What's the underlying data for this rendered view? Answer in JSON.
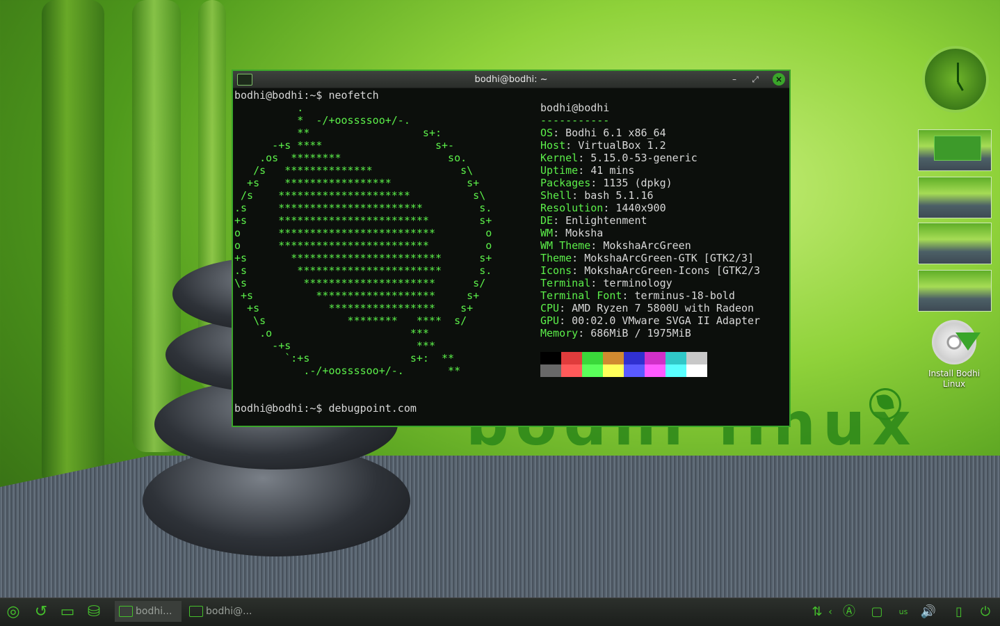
{
  "window": {
    "title": "bodhi@bodhi: ~"
  },
  "terminal": {
    "prompt_1": "bodhi@bodhi:~$ neofetch",
    "prompt_2": "bodhi@bodhi:~$ debugpoint.com",
    "ascii_art": [
      "          .",
      "          *  -/+oossssoo+/-.",
      "          **                  s+:",
      "      -+s ****                  s+-",
      "    .os  ********                 so.",
      "   /s   **************              s\\",
      "  +s    *****************            s+",
      " /s    *********************          s\\",
      ".s     ***********************         s.",
      "+s     ************************        s+",
      "o      *************************        o",
      "o      ************************         o",
      "+s       ************************      s+",
      ".s        ***********************      s.",
      "\\s         *********************      s/",
      " +s          *******************     s+",
      "  +s           *****************    s+",
      "   \\s             ********   ****  s/",
      "    .o                      ***",
      "      -+s                    ***",
      "        `:+s                s+:  **",
      "           .-/+oossssoo+/-.       **"
    ],
    "user_host": "bodhi@bodhi",
    "separator": "-----------",
    "info": [
      {
        "label": "OS",
        "value": "Bodhi 6.1 x86_64"
      },
      {
        "label": "Host",
        "value": "VirtualBox 1.2"
      },
      {
        "label": "Kernel",
        "value": "5.15.0-53-generic"
      },
      {
        "label": "Uptime",
        "value": "41 mins"
      },
      {
        "label": "Packages",
        "value": "1135 (dpkg)"
      },
      {
        "label": "Shell",
        "value": "bash 5.1.16"
      },
      {
        "label": "Resolution",
        "value": "1440x900"
      },
      {
        "label": "DE",
        "value": "Enlightenment"
      },
      {
        "label": "WM",
        "value": "Moksha"
      },
      {
        "label": "WM Theme",
        "value": "MokshaArcGreen"
      },
      {
        "label": "Theme",
        "value": "MokshaArcGreen-GTK [GTK2/3]"
      },
      {
        "label": "Icons",
        "value": "MokshaArcGreen-Icons [GTK2/3"
      },
      {
        "label": "Terminal",
        "value": "terminology"
      },
      {
        "label": "Terminal Font",
        "value": "terminus-18-bold"
      },
      {
        "label": "CPU",
        "value": "AMD Ryzen 7 5800U with Radeon"
      },
      {
        "label": "GPU",
        "value": "00:02.0 VMware SVGA II Adapter"
      },
      {
        "label": "Memory",
        "value": "686MiB / 1975MiB"
      }
    ],
    "palette_top": [
      "#000000",
      "#e03c3c",
      "#3ad83a",
      "#d08a30",
      "#3030d0",
      "#d030c8",
      "#30c8c8",
      "#c8c8c8"
    ],
    "palette_bottom": [
      "#686868",
      "#ff5a5a",
      "#5aff5a",
      "#ffff5a",
      "#5a5aff",
      "#ff5aff",
      "#5affff",
      "#ffffff"
    ]
  },
  "desktop": {
    "brand": "bodhi linux",
    "install_icon_label": "Install Bodhi Linux"
  },
  "taskbar": {
    "task_1": "bodhi...",
    "task_2": "bodhi@..."
  }
}
